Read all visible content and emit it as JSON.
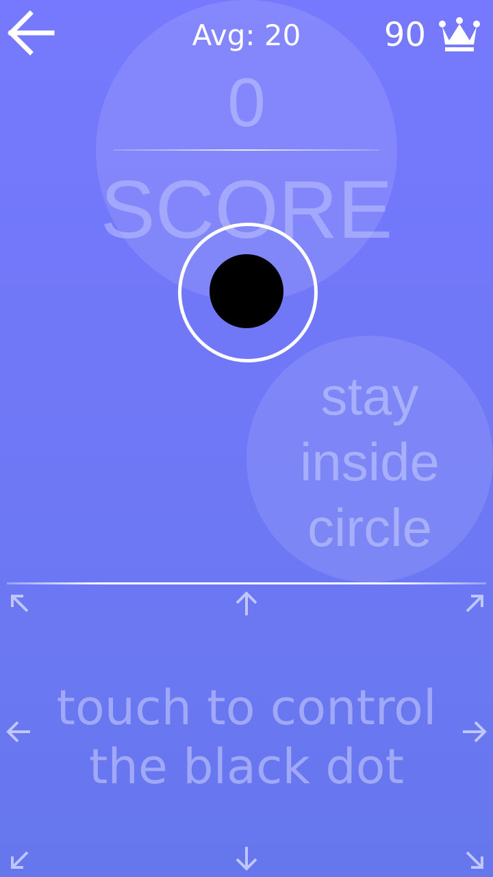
{
  "header": {
    "back_icon": "arrow-left-icon",
    "avg_text": "Avg: 20",
    "best_score": "90",
    "best_icon": "crown-icon"
  },
  "score": {
    "value": "0",
    "label": "SCORE"
  },
  "hint": {
    "lines": [
      "stay",
      "inside",
      "circle"
    ]
  },
  "control": {
    "lines": [
      "touch to control",
      "the black dot"
    ],
    "arrows": [
      "arrow-up-left-icon",
      "arrow-up-icon",
      "arrow-up-right-icon",
      "arrow-left-icon",
      "arrow-right-icon",
      "arrow-down-left-icon",
      "arrow-down-icon",
      "arrow-down-right-icon"
    ]
  },
  "colors": {
    "background_top": "#7679fd",
    "background_bottom": "#6677ed",
    "dot": "#000000",
    "ring": "#ffffff"
  }
}
